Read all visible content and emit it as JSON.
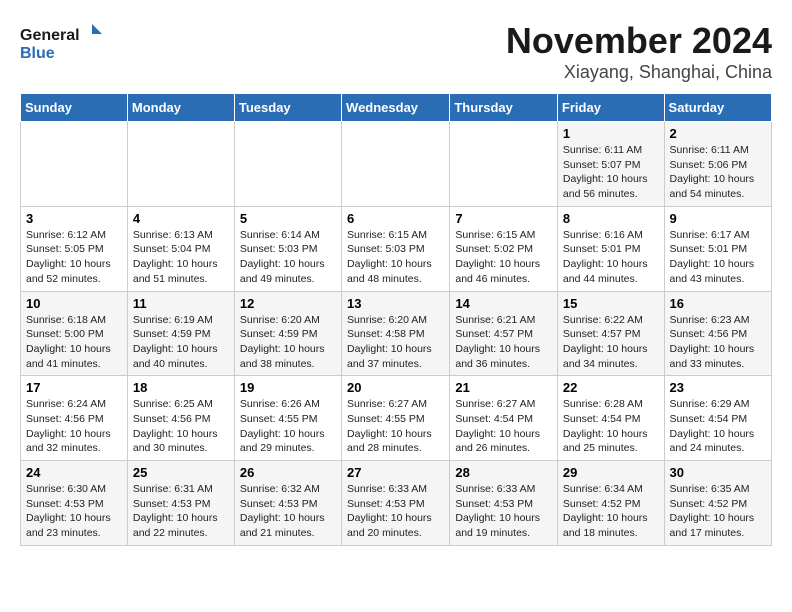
{
  "logo": {
    "line1": "General",
    "line2": "Blue"
  },
  "title": "November 2024",
  "location": "Xiayang, Shanghai, China",
  "days_of_week": [
    "Sunday",
    "Monday",
    "Tuesday",
    "Wednesday",
    "Thursday",
    "Friday",
    "Saturday"
  ],
  "weeks": [
    [
      {
        "day": "",
        "detail": ""
      },
      {
        "day": "",
        "detail": ""
      },
      {
        "day": "",
        "detail": ""
      },
      {
        "day": "",
        "detail": ""
      },
      {
        "day": "",
        "detail": ""
      },
      {
        "day": "1",
        "detail": "Sunrise: 6:11 AM\nSunset: 5:07 PM\nDaylight: 10 hours\nand 56 minutes."
      },
      {
        "day": "2",
        "detail": "Sunrise: 6:11 AM\nSunset: 5:06 PM\nDaylight: 10 hours\nand 54 minutes."
      }
    ],
    [
      {
        "day": "3",
        "detail": "Sunrise: 6:12 AM\nSunset: 5:05 PM\nDaylight: 10 hours\nand 52 minutes."
      },
      {
        "day": "4",
        "detail": "Sunrise: 6:13 AM\nSunset: 5:04 PM\nDaylight: 10 hours\nand 51 minutes."
      },
      {
        "day": "5",
        "detail": "Sunrise: 6:14 AM\nSunset: 5:03 PM\nDaylight: 10 hours\nand 49 minutes."
      },
      {
        "day": "6",
        "detail": "Sunrise: 6:15 AM\nSunset: 5:03 PM\nDaylight: 10 hours\nand 48 minutes."
      },
      {
        "day": "7",
        "detail": "Sunrise: 6:15 AM\nSunset: 5:02 PM\nDaylight: 10 hours\nand 46 minutes."
      },
      {
        "day": "8",
        "detail": "Sunrise: 6:16 AM\nSunset: 5:01 PM\nDaylight: 10 hours\nand 44 minutes."
      },
      {
        "day": "9",
        "detail": "Sunrise: 6:17 AM\nSunset: 5:01 PM\nDaylight: 10 hours\nand 43 minutes."
      }
    ],
    [
      {
        "day": "10",
        "detail": "Sunrise: 6:18 AM\nSunset: 5:00 PM\nDaylight: 10 hours\nand 41 minutes."
      },
      {
        "day": "11",
        "detail": "Sunrise: 6:19 AM\nSunset: 4:59 PM\nDaylight: 10 hours\nand 40 minutes."
      },
      {
        "day": "12",
        "detail": "Sunrise: 6:20 AM\nSunset: 4:59 PM\nDaylight: 10 hours\nand 38 minutes."
      },
      {
        "day": "13",
        "detail": "Sunrise: 6:20 AM\nSunset: 4:58 PM\nDaylight: 10 hours\nand 37 minutes."
      },
      {
        "day": "14",
        "detail": "Sunrise: 6:21 AM\nSunset: 4:57 PM\nDaylight: 10 hours\nand 36 minutes."
      },
      {
        "day": "15",
        "detail": "Sunrise: 6:22 AM\nSunset: 4:57 PM\nDaylight: 10 hours\nand 34 minutes."
      },
      {
        "day": "16",
        "detail": "Sunrise: 6:23 AM\nSunset: 4:56 PM\nDaylight: 10 hours\nand 33 minutes."
      }
    ],
    [
      {
        "day": "17",
        "detail": "Sunrise: 6:24 AM\nSunset: 4:56 PM\nDaylight: 10 hours\nand 32 minutes."
      },
      {
        "day": "18",
        "detail": "Sunrise: 6:25 AM\nSunset: 4:56 PM\nDaylight: 10 hours\nand 30 minutes."
      },
      {
        "day": "19",
        "detail": "Sunrise: 6:26 AM\nSunset: 4:55 PM\nDaylight: 10 hours\nand 29 minutes."
      },
      {
        "day": "20",
        "detail": "Sunrise: 6:27 AM\nSunset: 4:55 PM\nDaylight: 10 hours\nand 28 minutes."
      },
      {
        "day": "21",
        "detail": "Sunrise: 6:27 AM\nSunset: 4:54 PM\nDaylight: 10 hours\nand 26 minutes."
      },
      {
        "day": "22",
        "detail": "Sunrise: 6:28 AM\nSunset: 4:54 PM\nDaylight: 10 hours\nand 25 minutes."
      },
      {
        "day": "23",
        "detail": "Sunrise: 6:29 AM\nSunset: 4:54 PM\nDaylight: 10 hours\nand 24 minutes."
      }
    ],
    [
      {
        "day": "24",
        "detail": "Sunrise: 6:30 AM\nSunset: 4:53 PM\nDaylight: 10 hours\nand 23 minutes."
      },
      {
        "day": "25",
        "detail": "Sunrise: 6:31 AM\nSunset: 4:53 PM\nDaylight: 10 hours\nand 22 minutes."
      },
      {
        "day": "26",
        "detail": "Sunrise: 6:32 AM\nSunset: 4:53 PM\nDaylight: 10 hours\nand 21 minutes."
      },
      {
        "day": "27",
        "detail": "Sunrise: 6:33 AM\nSunset: 4:53 PM\nDaylight: 10 hours\nand 20 minutes."
      },
      {
        "day": "28",
        "detail": "Sunrise: 6:33 AM\nSunset: 4:53 PM\nDaylight: 10 hours\nand 19 minutes."
      },
      {
        "day": "29",
        "detail": "Sunrise: 6:34 AM\nSunset: 4:52 PM\nDaylight: 10 hours\nand 18 minutes."
      },
      {
        "day": "30",
        "detail": "Sunrise: 6:35 AM\nSunset: 4:52 PM\nDaylight: 10 hours\nand 17 minutes."
      }
    ]
  ]
}
